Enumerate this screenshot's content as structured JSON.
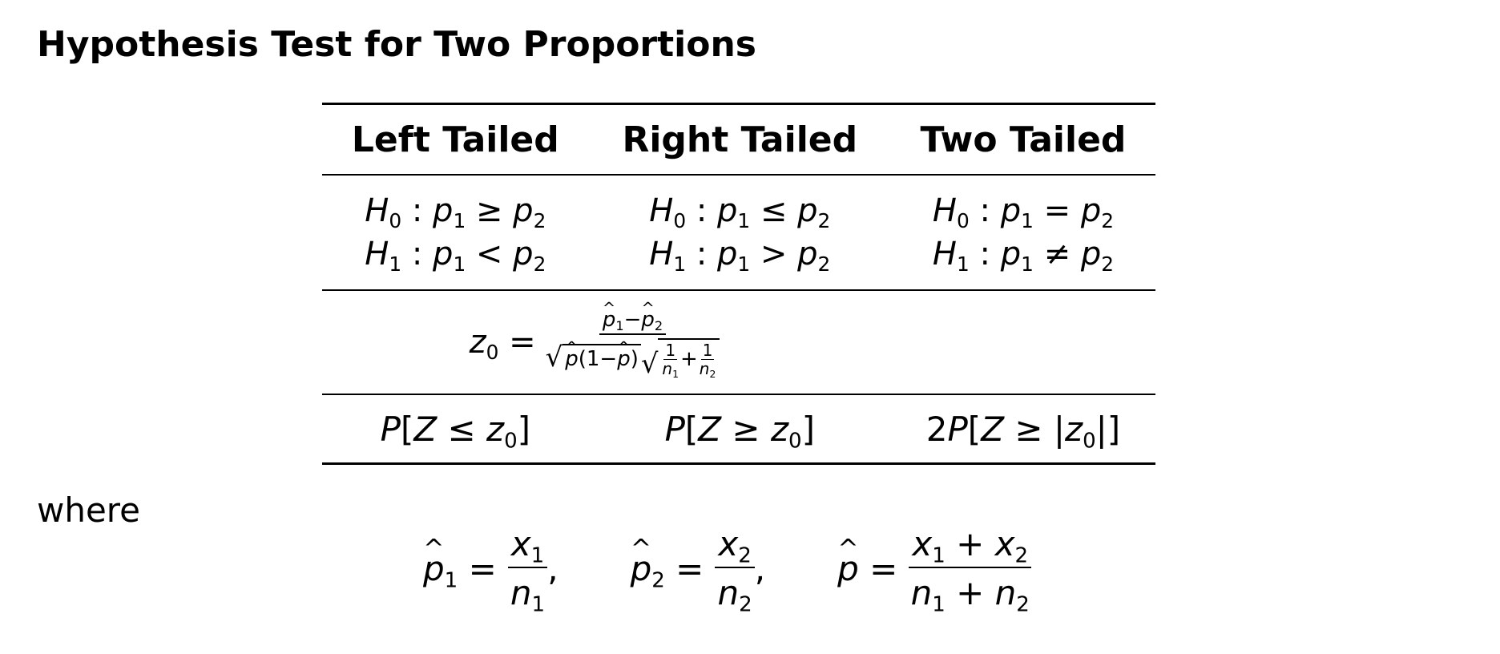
{
  "title": "Hypothesis Test for Two Proportions",
  "columns": [
    "Left Tailed",
    "Right Tailed",
    "Two Tailed"
  ],
  "hypotheses": [
    {
      "h0": "p1 ≥ p2",
      "h1": "p1 < p2"
    },
    {
      "h0": "p1 ≤ p2",
      "h1": "p1 > p2"
    },
    {
      "h0": "p1 = p2",
      "h1": "p1 ≠ p2"
    }
  ],
  "test_statistic": "z0 = (p̂1 − p̂2) / ( √(p̂(1−p̂)) · √(1/n1 + 1/n2) )",
  "p_values": [
    "P[Z ≤ z0]",
    "P[Z ≥ z0]",
    "2P[Z ≥ |z0|]"
  ],
  "where_label": "where",
  "definitions": [
    "p̂1 = x1 / n1,",
    "p̂2 = x2 / n2,",
    "p̂ = (x1 + x2) / (n1 + n2)"
  ]
}
